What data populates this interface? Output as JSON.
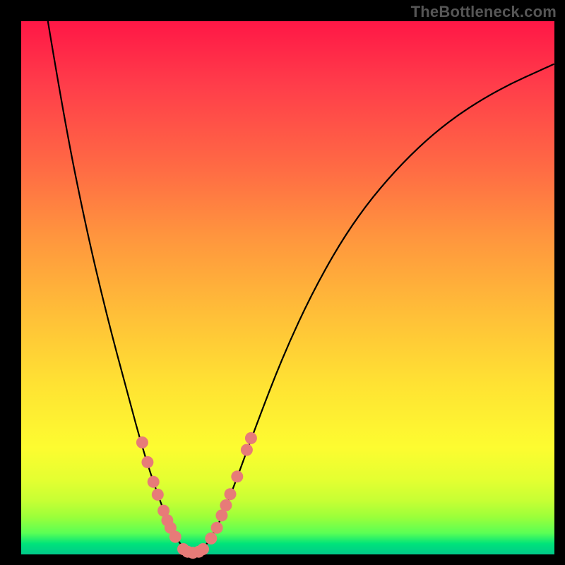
{
  "watermark": "TheBottleneck.com",
  "chart_data": {
    "type": "line",
    "title": "",
    "xlabel": "",
    "ylabel": "",
    "xlim": [
      0,
      100
    ],
    "ylim": [
      0,
      100
    ],
    "grid": false,
    "legend": false,
    "curve_points": [
      {
        "x": 5.0,
        "y": 100.0
      },
      {
        "x": 8.0,
        "y": 82.0
      },
      {
        "x": 12.0,
        "y": 62.0
      },
      {
        "x": 16.0,
        "y": 45.0
      },
      {
        "x": 20.0,
        "y": 30.0
      },
      {
        "x": 23.0,
        "y": 19.0
      },
      {
        "x": 26.0,
        "y": 10.0
      },
      {
        "x": 28.5,
        "y": 4.0
      },
      {
        "x": 30.5,
        "y": 1.0
      },
      {
        "x": 32.5,
        "y": 0.3
      },
      {
        "x": 34.5,
        "y": 1.3
      },
      {
        "x": 37.0,
        "y": 5.5
      },
      {
        "x": 40.0,
        "y": 13.0
      },
      {
        "x": 44.0,
        "y": 24.0
      },
      {
        "x": 49.0,
        "y": 37.0
      },
      {
        "x": 55.0,
        "y": 50.0
      },
      {
        "x": 62.0,
        "y": 62.0
      },
      {
        "x": 70.0,
        "y": 72.0
      },
      {
        "x": 79.0,
        "y": 80.5
      },
      {
        "x": 89.0,
        "y": 87.0
      },
      {
        "x": 100.0,
        "y": 92.0
      }
    ],
    "markers": [
      {
        "x": 22.7,
        "y": 21.0
      },
      {
        "x": 23.7,
        "y": 17.3
      },
      {
        "x": 24.8,
        "y": 13.6
      },
      {
        "x": 25.6,
        "y": 11.2
      },
      {
        "x": 26.7,
        "y": 8.2
      },
      {
        "x": 27.4,
        "y": 6.4
      },
      {
        "x": 28.0,
        "y": 5.0
      },
      {
        "x": 28.9,
        "y": 3.3
      },
      {
        "x": 30.4,
        "y": 1.0
      },
      {
        "x": 31.2,
        "y": 0.5
      },
      {
        "x": 32.2,
        "y": 0.3
      },
      {
        "x": 33.3,
        "y": 0.5
      },
      {
        "x": 34.1,
        "y": 1.0
      },
      {
        "x": 35.6,
        "y": 3.0
      },
      {
        "x": 36.7,
        "y": 5.0
      },
      {
        "x": 37.6,
        "y": 7.3
      },
      {
        "x": 38.4,
        "y": 9.2
      },
      {
        "x": 39.2,
        "y": 11.3
      },
      {
        "x": 40.5,
        "y": 14.6
      },
      {
        "x": 42.3,
        "y": 19.6
      },
      {
        "x": 43.1,
        "y": 21.8
      }
    ],
    "marker_color": "#e77b78",
    "background_gradient": [
      "#ff1746",
      "#ff3d4a",
      "#ff6c44",
      "#ff943e",
      "#ffbf38",
      "#ffe233",
      "#fdfc30",
      "#e4ff31",
      "#c6ff34",
      "#9bff3a",
      "#5aff55",
      "#00e37a",
      "#00c98a"
    ]
  }
}
